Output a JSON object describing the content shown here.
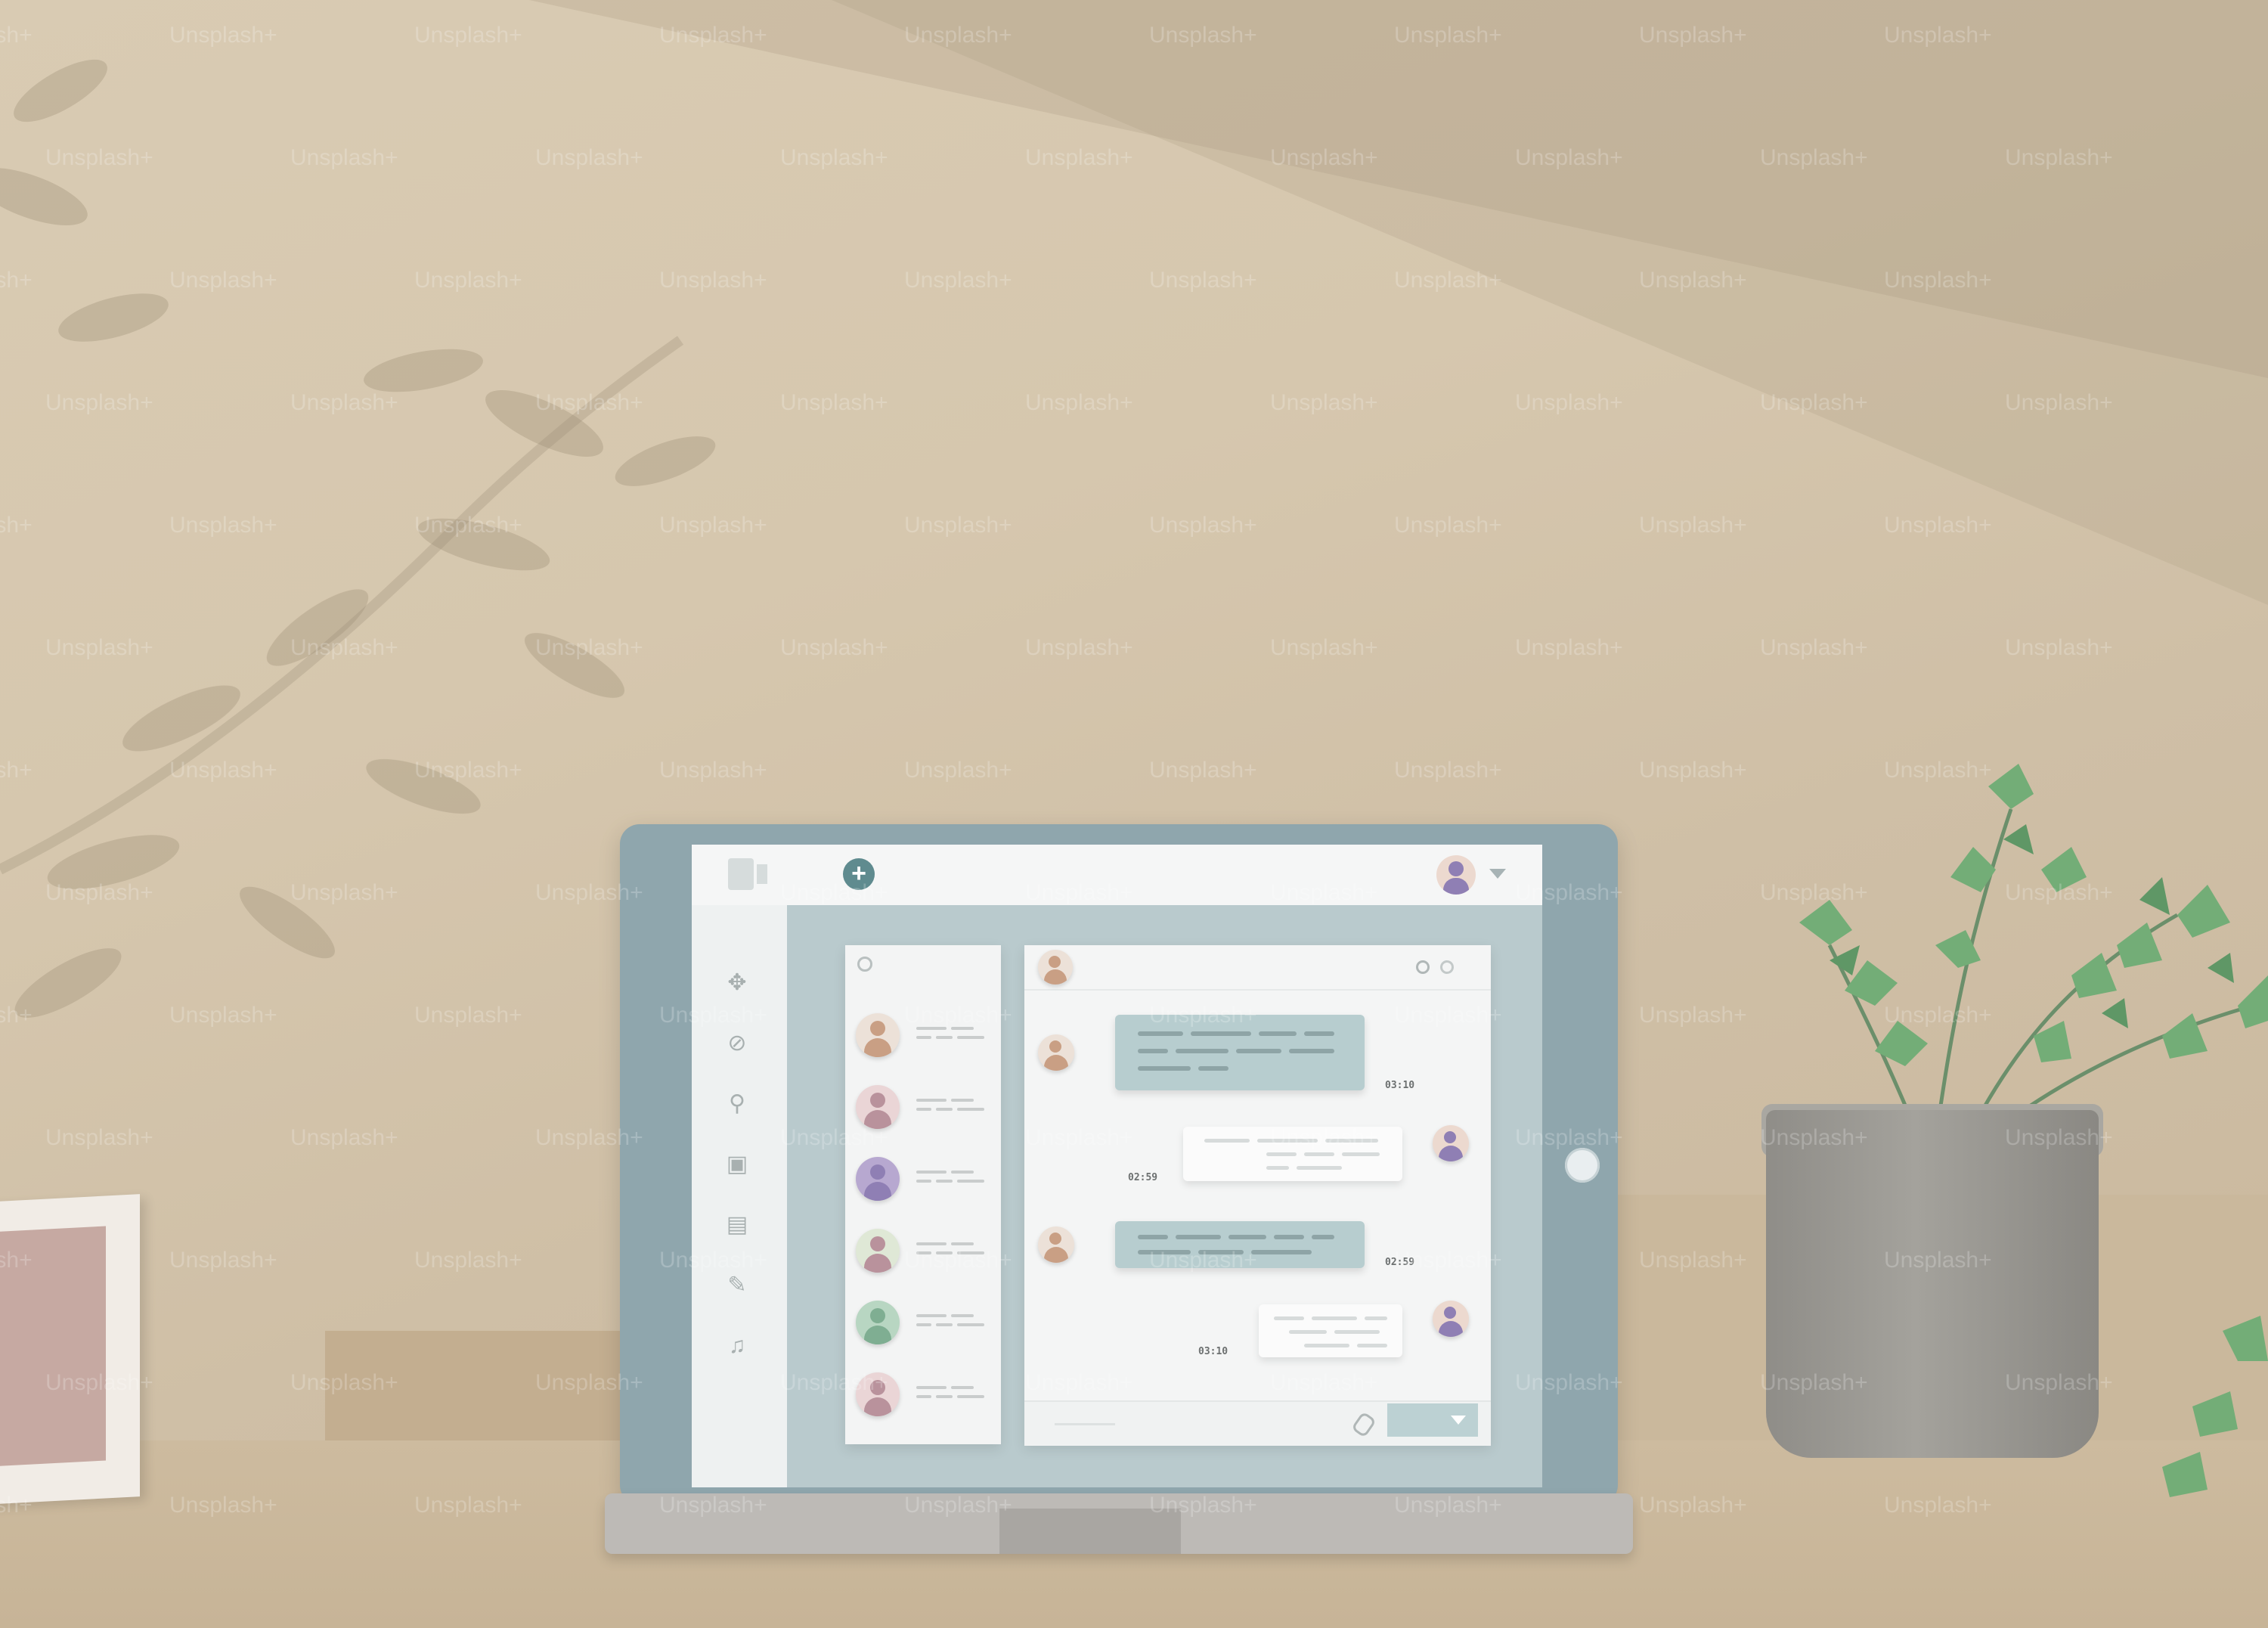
{
  "watermark": "Unsplash+",
  "app": {
    "add_button_symbol": "+",
    "sidebar_icons": [
      "move-icon",
      "settings-icon",
      "search-icon",
      "save-icon",
      "document-icon",
      "attachment-icon",
      "bell-icon"
    ],
    "contacts": [
      {
        "avatar_color": "#c99f84"
      },
      {
        "avatar_color": "#b9929c"
      },
      {
        "avatar_color": "#8f7fb4"
      },
      {
        "avatar_color": "#b9929c"
      },
      {
        "avatar_color": "#7fae92"
      },
      {
        "avatar_color": "#b9929c"
      }
    ],
    "messages": [
      {
        "direction": "in",
        "time": "03:10"
      },
      {
        "direction": "out",
        "time": "02:59"
      },
      {
        "direction": "in",
        "time": "02:59"
      },
      {
        "direction": "out",
        "time": "03:10"
      }
    ]
  },
  "colors": {
    "tablet_frame": "#8fa6ad",
    "accent": "#5f8b8f",
    "wall": "#d9cbb3"
  }
}
